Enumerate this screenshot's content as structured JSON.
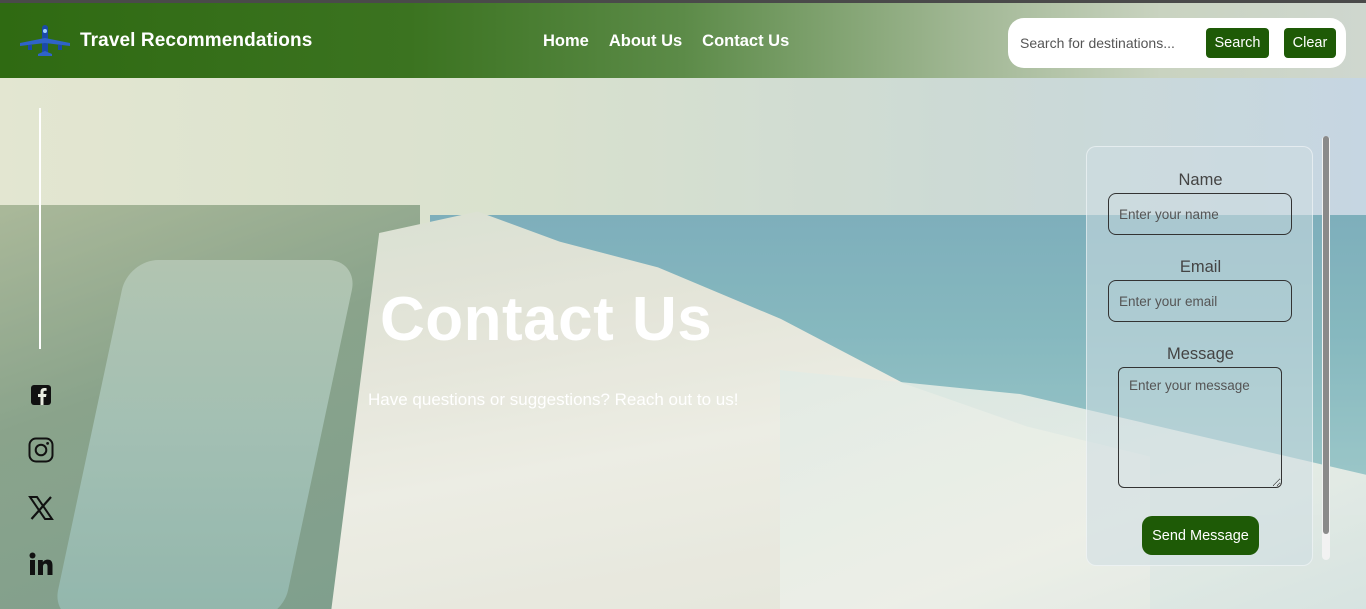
{
  "header": {
    "brand": "Travel Recommendations",
    "nav": [
      {
        "label": "Home"
      },
      {
        "label": "About Us"
      },
      {
        "label": "Contact Us"
      }
    ],
    "search": {
      "placeholder": "Search for destinations...",
      "search_label": "Search",
      "clear_label": "Clear"
    },
    "accent_color": "#1e5a06"
  },
  "social": [
    {
      "icon": "facebook-icon"
    },
    {
      "icon": "instagram-icon"
    },
    {
      "icon": "x-icon"
    },
    {
      "icon": "linkedin-icon"
    }
  ],
  "hero": {
    "title": "Contact Us",
    "subtitle": "Have questions or suggestions? Reach out to us!"
  },
  "form": {
    "name_label": "Name",
    "name_placeholder": "Enter your name",
    "email_label": "Email",
    "email_placeholder": "Enter your email",
    "message_label": "Message",
    "message_placeholder": "Enter your message",
    "submit_label": "Send Message"
  }
}
